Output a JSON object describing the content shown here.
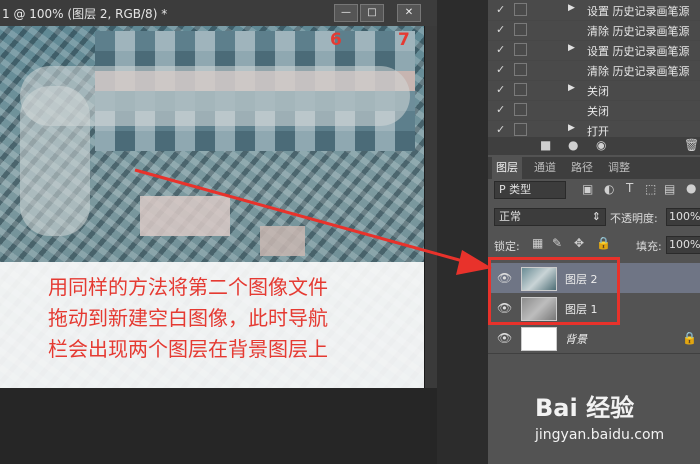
{
  "document": {
    "title": "1 @ 100% (图层 2, RGB/8) *",
    "marker_numbers": [
      "6",
      "7"
    ],
    "window_buttons": [
      "—",
      "□",
      "✕"
    ]
  },
  "history": {
    "items": [
      {
        "label": "设置 历史记录画笔源",
        "has_arrow": true
      },
      {
        "label": "清除 历史记录画笔源",
        "has_arrow": false
      },
      {
        "label": "设置 历史记录画笔源",
        "has_arrow": true
      },
      {
        "label": "清除 历史记录画笔源",
        "has_arrow": false
      },
      {
        "label": "关闭",
        "has_arrow": true
      },
      {
        "label": "关闭",
        "has_arrow": false
      },
      {
        "label": "打开",
        "has_arrow": true
      }
    ]
  },
  "layers_panel": {
    "tabs": [
      "图层",
      "通道",
      "路径",
      "调整"
    ],
    "filter_label": "P 类型",
    "blend_mode": "正常",
    "opacity_label": "不透明度:",
    "opacity_value": "100%",
    "lock_label": "锁定:",
    "fill_label": "填充:",
    "fill_value": "100%",
    "layers": [
      {
        "name": "图层 2",
        "selected": true
      },
      {
        "name": "图层 1",
        "selected": false
      },
      {
        "name": "背景",
        "selected": false
      }
    ]
  },
  "annotation": {
    "lines": [
      "用同样的方法将第二个图像文件",
      "拖动到新建空白图像，此时导航",
      "栏会出现两个图层在背景图层上"
    ],
    "color": "#e53a32"
  },
  "watermark": {
    "brand": "Bai 经验",
    "url": "jingyan.baidu.com"
  }
}
